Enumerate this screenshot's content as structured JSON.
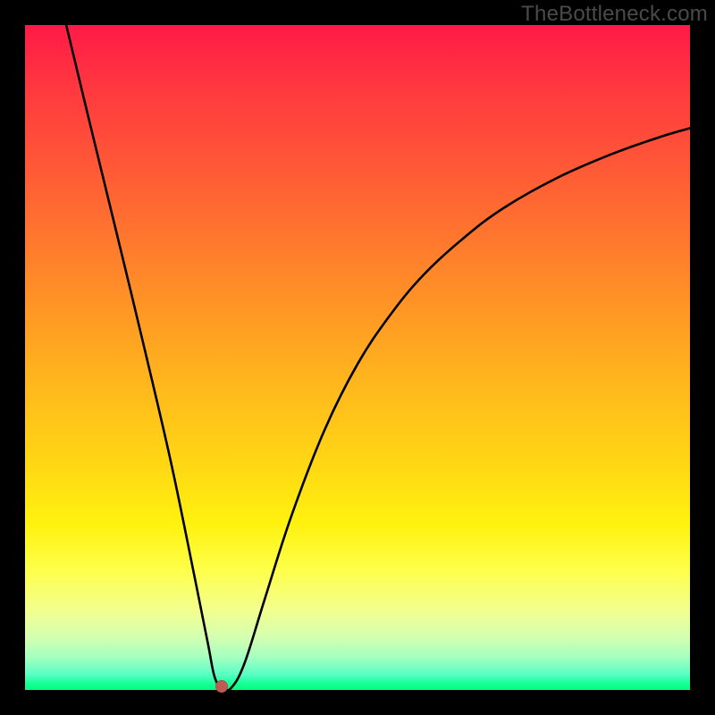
{
  "watermark": "TheBottleneck.com",
  "chart_data": {
    "type": "line",
    "title": "",
    "xlabel": "",
    "ylabel": "",
    "xlim": [
      0,
      1
    ],
    "ylim": [
      0,
      1
    ],
    "gradient": [
      "#ff1a47",
      "#ff7a2d",
      "#ffd714",
      "#feff4a",
      "#00ff7a"
    ],
    "marker": {
      "x": 0.296,
      "y": 0.005,
      "color": "#c05a55"
    },
    "series": [
      {
        "name": "curve",
        "stroke": "#000000",
        "x": [
          0.062,
          0.1,
          0.14,
          0.18,
          0.22,
          0.255,
          0.275,
          0.285,
          0.296,
          0.31,
          0.33,
          0.36,
          0.4,
          0.45,
          0.5,
          0.55,
          0.6,
          0.66,
          0.72,
          0.8,
          0.88,
          0.95,
          1.0
        ],
        "y": [
          1.0,
          0.842,
          0.678,
          0.512,
          0.34,
          0.17,
          0.07,
          0.02,
          0.003,
          0.003,
          0.04,
          0.135,
          0.26,
          0.39,
          0.49,
          0.565,
          0.625,
          0.68,
          0.725,
          0.77,
          0.805,
          0.83,
          0.845
        ]
      }
    ]
  }
}
